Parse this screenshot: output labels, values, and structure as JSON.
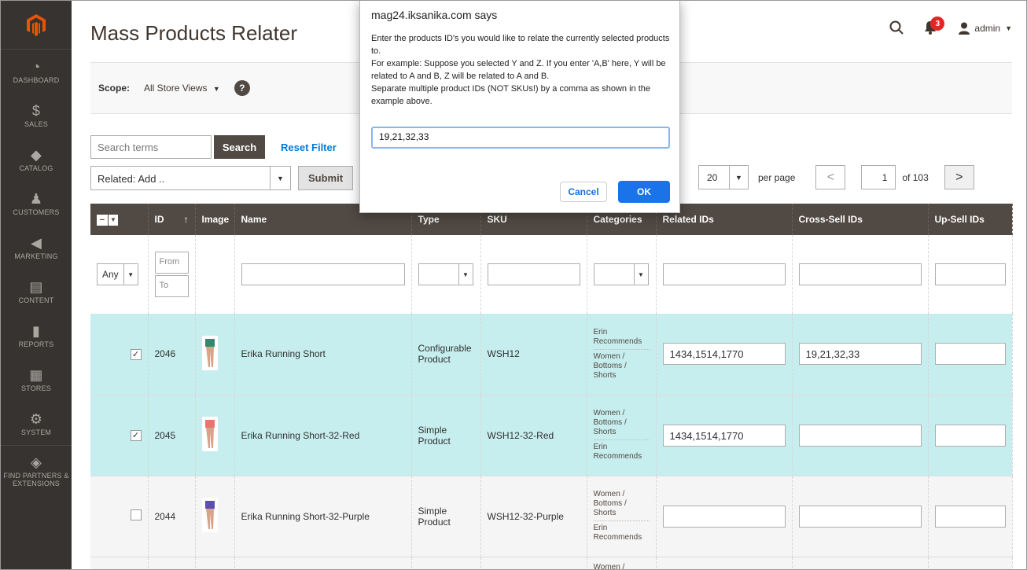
{
  "sidebar": {
    "items": [
      {
        "label": "DASHBOARD"
      },
      {
        "label": "SALES"
      },
      {
        "label": "CATALOG"
      },
      {
        "label": "CUSTOMERS"
      },
      {
        "label": "MARKETING"
      },
      {
        "label": "CONTENT"
      },
      {
        "label": "REPORTS"
      },
      {
        "label": "STORES"
      },
      {
        "label": "SYSTEM"
      },
      {
        "label": "FIND PARTNERS & EXTENSIONS"
      }
    ]
  },
  "header": {
    "title": "Mass Products Relater",
    "notification_count": "3",
    "user": "admin"
  },
  "scope": {
    "label": "Scope:",
    "value": "All Store Views",
    "help": "?"
  },
  "search": {
    "placeholder": "Search terms",
    "button": "Search",
    "reset": "Reset Filter"
  },
  "actions": {
    "selected": "Related: Add ..",
    "submit": "Submit"
  },
  "pager": {
    "per_page_value": "20",
    "per_page_label": "per page",
    "prev": "<",
    "page": "1",
    "of": "of 103",
    "next": ">"
  },
  "grid": {
    "columns": [
      "ID",
      "Image",
      "Name",
      "Type",
      "SKU",
      "Categories",
      "Related IDs",
      "Cross-Sell IDs",
      "Up-Sell IDs"
    ],
    "filter": {
      "any": "Any",
      "from": "From",
      "to": "To"
    },
    "rows": [
      {
        "checked": true,
        "id": "2046",
        "name": "Erika Running Short",
        "type": "Configurable Product",
        "sku": "WSH12",
        "cat1": "Erin Recommends",
        "cat2": "Women / Bottoms / Shorts",
        "related": "1434,1514,1770",
        "crosssell": "19,21,32,33",
        "upsell": ""
      },
      {
        "checked": true,
        "id": "2045",
        "name": "Erika Running Short-32-Red",
        "type": "Simple Product",
        "sku": "WSH12-32-Red",
        "cat1": "Women / Bottoms / Shorts",
        "cat2": "Erin Recommends",
        "related": "1434,1514,1770",
        "crosssell": "",
        "upsell": ""
      },
      {
        "checked": false,
        "id": "2044",
        "name": "Erika Running Short-32-Purple",
        "type": "Simple Product",
        "sku": "WSH12-32-Purple",
        "cat1": "Women / Bottoms / Shorts",
        "cat2": "Erin Recommends",
        "related": "",
        "crosssell": "",
        "upsell": ""
      }
    ],
    "partial_row_cat": "Women /"
  },
  "dialog": {
    "title": "mag24.iksanika.com says",
    "line1": "Enter the products ID's you would like to relate the currently selected products to.",
    "line2": "For example: Suppose you selected Y and Z.  If you enter 'A,B' here, Y will be related to A and B, Z will be related to A and B.",
    "line3": "Separate multiple product IDs (NOT SKUs!) by a comma as shown in the example above.",
    "input_value": "19,21,32,33",
    "cancel": "Cancel",
    "ok": "OK"
  },
  "colors": {
    "sidebar_bg": "#373330",
    "header_bg": "#514943",
    "selected_row": "#c7eeee",
    "logo_orange": "#eb5202",
    "link_blue": "#007bdb",
    "badge_red": "#e22626"
  }
}
